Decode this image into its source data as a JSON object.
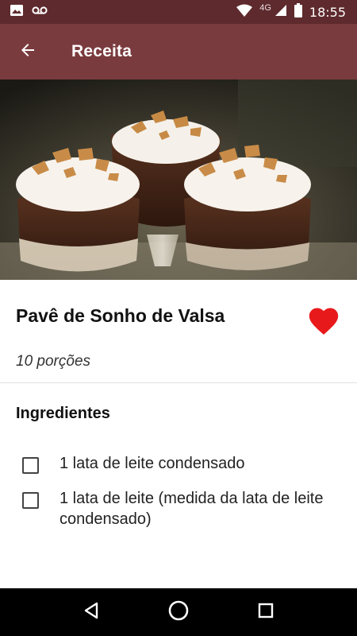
{
  "status_bar": {
    "network_type": "4G",
    "time": "18:55",
    "icons": [
      "image-notification-icon",
      "voicemail-icon",
      "wifi-icon",
      "signal-icon",
      "battery-icon"
    ]
  },
  "app_bar": {
    "title": "Receita",
    "back_icon": "arrow-left-icon",
    "color": "#7a3b3e",
    "status_color": "#5e2a2d"
  },
  "recipe": {
    "title": "Pavê de Sonho de Valsa",
    "portions": "10 porções",
    "favorite": true,
    "favorite_color": "#e8191b"
  },
  "ingredients": {
    "heading": "Ingredientes",
    "items": [
      {
        "text": "1 lata de leite condensado",
        "checked": false
      },
      {
        "text": "1 lata de leite (medida da lata de leite condensado)",
        "checked": false
      }
    ]
  },
  "navigation": {
    "icons": [
      "back-triangle-icon",
      "home-circle-icon",
      "recents-square-icon"
    ]
  }
}
